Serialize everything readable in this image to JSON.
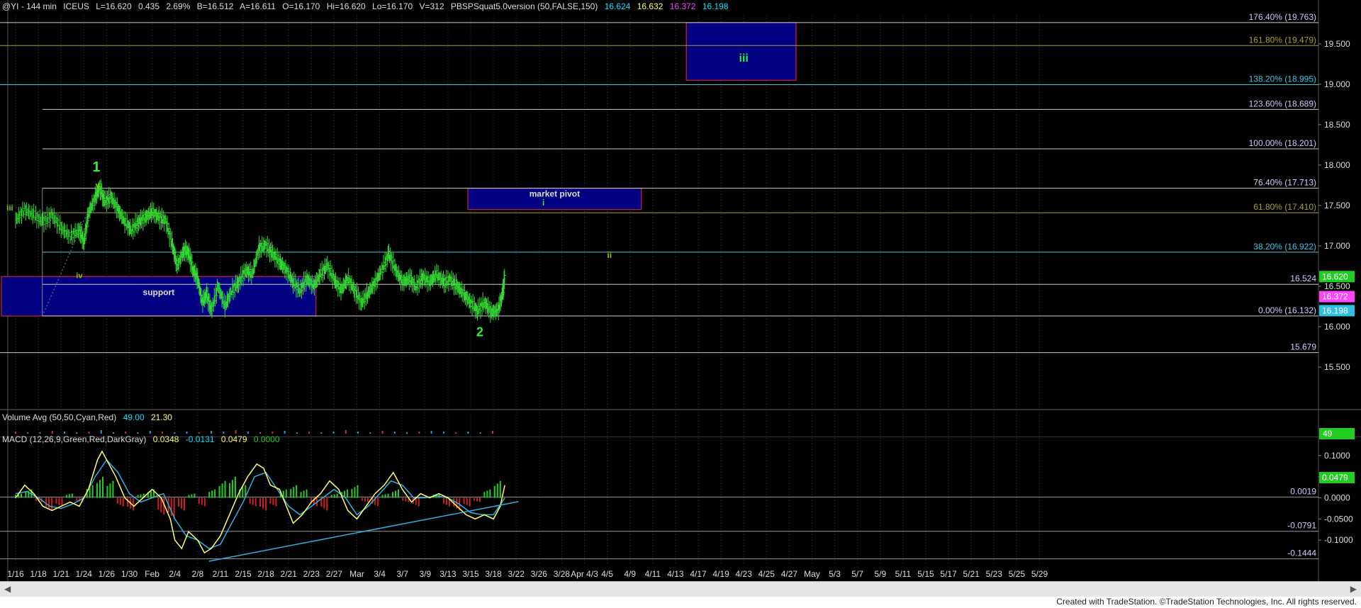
{
  "header": {
    "symbol": "@YI - 144 min",
    "exchange": "ICEUS",
    "last": "L=16.620",
    "change": "0.435",
    "change_pct": "2.69%",
    "bid": "B=16.512",
    "ask": "A=16.611",
    "open": "O=16.170",
    "high": "Hi=16.620",
    "low": "Lo=16.170",
    "volume": "V=312",
    "indicator": "PBSPSquat5.0version (50,FALSE,150)",
    "ind_values": [
      {
        "text": "16.624",
        "color": "#00e5ff"
      },
      {
        "text": "16.632",
        "color": "#ffff66"
      },
      {
        "text": "16.372",
        "color": "#ff44ff"
      },
      {
        "text": "16.198",
        "color": "#00e5ff"
      }
    ]
  },
  "volume_panel": {
    "label": "Volume Avg (50,50,Cyan,Red)",
    "v1": "49.00",
    "v2": "21.30",
    "axis_label": "49"
  },
  "macd_panel": {
    "label": "MACD (12,26,9,Green,Red,DarkGray)",
    "v1": "0.0348",
    "v2": "-0.0131",
    "v3": "0.0479",
    "v4": "0.0000",
    "ticks": [
      {
        "v": 0.1,
        "label": "0.1000"
      },
      {
        "v": 0.05,
        "label": "0.0500"
      },
      {
        "v": 0.0,
        "label": "0.0000"
      },
      {
        "v": -0.05,
        "label": "-0.0500"
      },
      {
        "v": -0.1,
        "label": "-0.1000"
      }
    ],
    "levels": [
      {
        "v": 0.0019,
        "label": "0.0019"
      },
      {
        "v": -0.0791,
        "label": "-0.0791"
      },
      {
        "v": -0.1444,
        "label": "-0.1444"
      }
    ],
    "badge": {
      "v": 0.0479,
      "label": "0.0479",
      "color": "#22cc22"
    }
  },
  "chart_data": {
    "type": "candlestick",
    "price_ticks": [
      {
        "v": 19.5,
        "label": "19.500"
      },
      {
        "v": 19.0,
        "label": "19.000"
      },
      {
        "v": 18.5,
        "label": "18.500"
      },
      {
        "v": 18.0,
        "label": "18.000"
      },
      {
        "v": 17.5,
        "label": "17.500"
      },
      {
        "v": 17.0,
        "label": "17.000"
      },
      {
        "v": 16.5,
        "label": "16.500"
      },
      {
        "v": 16.0,
        "label": "16.000"
      },
      {
        "v": 15.5,
        "label": "15.500"
      }
    ],
    "fib_levels": [
      {
        "v": 19.763,
        "label": "176.40% (19.763)",
        "color": "#cccccc"
      },
      {
        "v": 19.479,
        "label": "161.80% (19.479)",
        "color": "#a8a030"
      },
      {
        "v": 18.995,
        "label": "138.20% (18.995)",
        "color": "#40c8e0"
      },
      {
        "v": 18.689,
        "label": "123.60% (18.689)",
        "color": "#cccccc"
      },
      {
        "v": 18.201,
        "label": "100.00% (18.201)",
        "color": "#cccccc"
      },
      {
        "v": 17.713,
        "label": "76.40% (17.713)",
        "color": "#cccccc"
      },
      {
        "v": 17.41,
        "label": "61.80% (17.410)",
        "color": "#a8a030"
      },
      {
        "v": 16.922,
        "label": "38.20% (16.922)",
        "color": "#40c8e0"
      },
      {
        "v": 16.524,
        "label": "16.524",
        "color": "#cccccc"
      },
      {
        "v": 16.132,
        "label": "0.00% (16.132)",
        "color": "#cccccc"
      },
      {
        "v": 15.679,
        "label": "15.679",
        "color": "#cccccc"
      }
    ],
    "price_badges": [
      {
        "v": 16.62,
        "label": "16.620",
        "color": "#22cc22"
      },
      {
        "v": 16.372,
        "label": "16.372",
        "color": "#ff44ff"
      },
      {
        "v": 16.198,
        "label": "16.198",
        "color": "#30c0e0"
      }
    ],
    "x_labels": [
      "1/16",
      "1/18",
      "1/21",
      "1/24",
      "1/26",
      "1/30",
      "Feb",
      "2/4",
      "2/8",
      "2/11",
      "2/15",
      "2/18",
      "2/21",
      "2/23",
      "2/27",
      "Mar",
      "3/4",
      "3/7",
      "3/9",
      "3/13",
      "3/15",
      "3/18",
      "3/22",
      "3/26",
      "3/28",
      "Apr 4/3",
      "4/5",
      "4/9",
      "4/11",
      "4/13",
      "4/17",
      "4/19",
      "4/23",
      "4/25",
      "4/27",
      "May",
      "5/3",
      "5/7",
      "5/9",
      "5/11",
      "5/15",
      "5/17",
      "5/21",
      "5/23",
      "5/25",
      "5/29"
    ],
    "zones": [
      {
        "name": "support",
        "label": "support",
        "x0": 0,
        "x1": 13.2,
        "y0": 16.132,
        "y1": 16.62
      },
      {
        "name": "market-pivot",
        "label": "market pivot",
        "x0": 20.5,
        "x1": 27.5,
        "y0": 17.45,
        "y1": 17.713
      },
      {
        "name": "wave-iii-target",
        "label": "",
        "x0": 30.1,
        "x1": 34.3,
        "y0": 19.05,
        "y1": 19.763
      }
    ],
    "wave_labels": [
      {
        "text": "1",
        "x": 3.55,
        "v": 17.92,
        "size": 20,
        "color": "#33ee33"
      },
      {
        "text": "2",
        "x": 20.4,
        "v": 15.88,
        "size": 18,
        "color": "#33ee33"
      },
      {
        "text": "iii",
        "x": 0.0,
        "v": 17.44,
        "size": 11,
        "color": "#88cc00"
      },
      {
        "text": "iv",
        "x": 2.8,
        "v": 16.6,
        "size": 11,
        "color": "#88cc00"
      },
      {
        "text": "v",
        "x": 3.6,
        "v": 17.72,
        "size": 11,
        "color": "#88cc00"
      },
      {
        "text": "i",
        "x": 23.2,
        "v": 17.5,
        "size": 12,
        "color": "#33ee33"
      },
      {
        "text": "ii",
        "x": 26.1,
        "v": 16.85,
        "size": 12,
        "color": "#88cc00"
      },
      {
        "text": "iii",
        "x": 32.0,
        "v": 19.28,
        "size": 16,
        "color": "#33ee33"
      }
    ],
    "price_path": [
      [
        0,
        17.32
      ],
      [
        0.4,
        17.45
      ],
      [
        0.8,
        17.38
      ],
      [
        1.2,
        17.3
      ],
      [
        1.6,
        17.38
      ],
      [
        2.0,
        17.22
      ],
      [
        2.4,
        17.12
      ],
      [
        2.8,
        17.2
      ],
      [
        3.0,
        17.05
      ],
      [
        3.2,
        17.4
      ],
      [
        3.5,
        17.6
      ],
      [
        3.7,
        17.72
      ],
      [
        3.9,
        17.55
      ],
      [
        4.2,
        17.6
      ],
      [
        4.5,
        17.45
      ],
      [
        4.8,
        17.3
      ],
      [
        5.1,
        17.2
      ],
      [
        5.4,
        17.3
      ],
      [
        5.7,
        17.35
      ],
      [
        6.0,
        17.42
      ],
      [
        6.3,
        17.35
      ],
      [
        6.6,
        17.3
      ],
      [
        6.9,
        17.0
      ],
      [
        7.1,
        16.75
      ],
      [
        7.4,
        16.95
      ],
      [
        7.6,
        16.92
      ],
      [
        7.8,
        16.7
      ],
      [
        8.0,
        16.6
      ],
      [
        8.2,
        16.3
      ],
      [
        8.4,
        16.4
      ],
      [
        8.6,
        16.2
      ],
      [
        8.9,
        16.5
      ],
      [
        9.2,
        16.25
      ],
      [
        9.5,
        16.45
      ],
      [
        9.8,
        16.55
      ],
      [
        10.1,
        16.7
      ],
      [
        10.4,
        16.65
      ],
      [
        10.7,
        16.98
      ],
      [
        11.0,
        17.0
      ],
      [
        11.3,
        16.9
      ],
      [
        11.6,
        16.8
      ],
      [
        11.9,
        16.7
      ],
      [
        12.2,
        16.55
      ],
      [
        12.5,
        16.45
      ],
      [
        12.8,
        16.6
      ],
      [
        13.1,
        16.5
      ],
      [
        13.4,
        16.65
      ],
      [
        13.7,
        16.75
      ],
      [
        14.0,
        16.58
      ],
      [
        14.3,
        16.45
      ],
      [
        14.6,
        16.6
      ],
      [
        14.9,
        16.45
      ],
      [
        15.2,
        16.3
      ],
      [
        15.5,
        16.42
      ],
      [
        15.8,
        16.55
      ],
      [
        16.1,
        16.7
      ],
      [
        16.4,
        16.9
      ],
      [
        16.7,
        16.7
      ],
      [
        17.0,
        16.55
      ],
      [
        17.3,
        16.6
      ],
      [
        17.6,
        16.5
      ],
      [
        17.9,
        16.62
      ],
      [
        18.2,
        16.55
      ],
      [
        18.5,
        16.65
      ],
      [
        18.8,
        16.55
      ],
      [
        19.1,
        16.58
      ],
      [
        19.4,
        16.5
      ],
      [
        19.7,
        16.4
      ],
      [
        20.0,
        16.3
      ],
      [
        20.3,
        16.2
      ],
      [
        20.6,
        16.3
      ],
      [
        20.9,
        16.18
      ],
      [
        21.2,
        16.2
      ],
      [
        21.4,
        16.4
      ],
      [
        21.5,
        16.62
      ]
    ],
    "volume_bars": [
      3,
      2,
      2,
      4,
      3,
      2,
      3,
      5,
      2,
      3,
      2,
      4,
      3,
      2,
      3,
      2,
      4,
      3,
      5,
      3,
      2,
      3,
      4,
      2,
      3,
      2,
      3,
      5,
      3,
      2,
      4,
      3,
      2,
      3,
      4,
      3,
      2,
      3,
      2,
      4
    ],
    "macd_line": [
      [
        0,
        0.0
      ],
      [
        0.4,
        0.03
      ],
      [
        0.8,
        0.01
      ],
      [
        1.2,
        -0.02
      ],
      [
        1.6,
        -0.03
      ],
      [
        2.0,
        -0.02
      ],
      [
        2.4,
        -0.01
      ],
      [
        2.8,
        -0.02
      ],
      [
        3.2,
        0.02
      ],
      [
        3.6,
        0.09
      ],
      [
        3.8,
        0.11
      ],
      [
        4.1,
        0.08
      ],
      [
        4.4,
        0.05
      ],
      [
        4.8,
        0.0
      ],
      [
        5.2,
        -0.02
      ],
      [
        5.6,
        0.0
      ],
      [
        6.0,
        0.02
      ],
      [
        6.4,
        0.0
      ],
      [
        6.8,
        -0.05
      ],
      [
        7.0,
        -0.1
      ],
      [
        7.3,
        -0.12
      ],
      [
        7.6,
        -0.08
      ],
      [
        8.0,
        -0.1
      ],
      [
        8.3,
        -0.13
      ],
      [
        8.6,
        -0.12
      ],
      [
        9.0,
        -0.09
      ],
      [
        9.4,
        -0.04
      ],
      [
        9.8,
        0.01
      ],
      [
        10.2,
        0.05
      ],
      [
        10.6,
        0.08
      ],
      [
        10.9,
        0.07
      ],
      [
        11.2,
        0.03
      ],
      [
        11.6,
        0.02
      ],
      [
        11.9,
        -0.02
      ],
      [
        12.2,
        -0.06
      ],
      [
        12.6,
        -0.04
      ],
      [
        13.0,
        -0.01
      ],
      [
        13.4,
        0.01
      ],
      [
        13.8,
        0.04
      ],
      [
        14.2,
        0.02
      ],
      [
        14.6,
        -0.03
      ],
      [
        15.0,
        -0.05
      ],
      [
        15.4,
        -0.02
      ],
      [
        15.8,
        0.01
      ],
      [
        16.2,
        0.03
      ],
      [
        16.6,
        0.06
      ],
      [
        17.0,
        0.02
      ],
      [
        17.4,
        -0.01
      ],
      [
        17.8,
        0.01
      ],
      [
        18.2,
        0.0
      ],
      [
        18.6,
        0.01
      ],
      [
        19.0,
        0.0
      ],
      [
        19.4,
        -0.02
      ],
      [
        19.8,
        -0.04
      ],
      [
        20.2,
        -0.05
      ],
      [
        20.6,
        -0.04
      ],
      [
        21.0,
        -0.05
      ],
      [
        21.3,
        -0.02
      ],
      [
        21.5,
        0.03
      ]
    ],
    "macd_signal": [
      [
        0,
        0.01
      ],
      [
        0.5,
        0.015
      ],
      [
        1.0,
        0.0
      ],
      [
        1.5,
        -0.02
      ],
      [
        2.0,
        -0.025
      ],
      [
        2.5,
        -0.015
      ],
      [
        3.0,
        0.0
      ],
      [
        3.5,
        0.05
      ],
      [
        4.0,
        0.09
      ],
      [
        4.5,
        0.06
      ],
      [
        5.0,
        0.01
      ],
      [
        5.5,
        -0.01
      ],
      [
        6.0,
        0.0
      ],
      [
        6.5,
        0.01
      ],
      [
        7.0,
        -0.05
      ],
      [
        7.5,
        -0.09
      ],
      [
        8.0,
        -0.1
      ],
      [
        8.5,
        -0.12
      ],
      [
        9.0,
        -0.11
      ],
      [
        9.5,
        -0.06
      ],
      [
        10.0,
        -0.01
      ],
      [
        10.5,
        0.05
      ],
      [
        11.0,
        0.06
      ],
      [
        11.5,
        0.02
      ],
      [
        12.0,
        -0.02
      ],
      [
        12.5,
        -0.04
      ],
      [
        13.0,
        -0.02
      ],
      [
        13.5,
        0.0
      ],
      [
        14.0,
        0.02
      ],
      [
        14.5,
        0.0
      ],
      [
        15.0,
        -0.04
      ],
      [
        15.5,
        -0.02
      ],
      [
        16.0,
        0.01
      ],
      [
        16.5,
        0.04
      ],
      [
        17.0,
        0.03
      ],
      [
        17.5,
        0.0
      ],
      [
        18.0,
        0.0
      ],
      [
        18.5,
        0.005
      ],
      [
        19.0,
        0.0
      ],
      [
        19.5,
        -0.015
      ],
      [
        20.0,
        -0.035
      ],
      [
        20.5,
        -0.04
      ],
      [
        21.0,
        -0.04
      ],
      [
        21.5,
        0.0
      ]
    ],
    "macd_hist": [
      0.01,
      0.02,
      -0.01,
      -0.03,
      -0.02,
      0.01,
      -0.01,
      0.03,
      0.05,
      0.04,
      -0.02,
      -0.03,
      0.01,
      0.02,
      -0.04,
      -0.05,
      -0.03,
      0.01,
      -0.02,
      0.02,
      0.04,
      0.05,
      0.03,
      -0.02,
      -0.03,
      -0.02,
      0.02,
      0.03,
      0.02,
      -0.02,
      -0.03,
      0.01,
      0.02,
      0.03,
      -0.01,
      -0.02,
      0.01,
      0.02,
      -0.01,
      -0.02,
      0.0,
      0.01,
      -0.02,
      -0.03,
      -0.02,
      -0.01,
      0.02,
      0.04
    ]
  },
  "footer": {
    "credit": "Created with TradeStation. ©TradeStation Technologies, Inc. All rights reserved."
  }
}
